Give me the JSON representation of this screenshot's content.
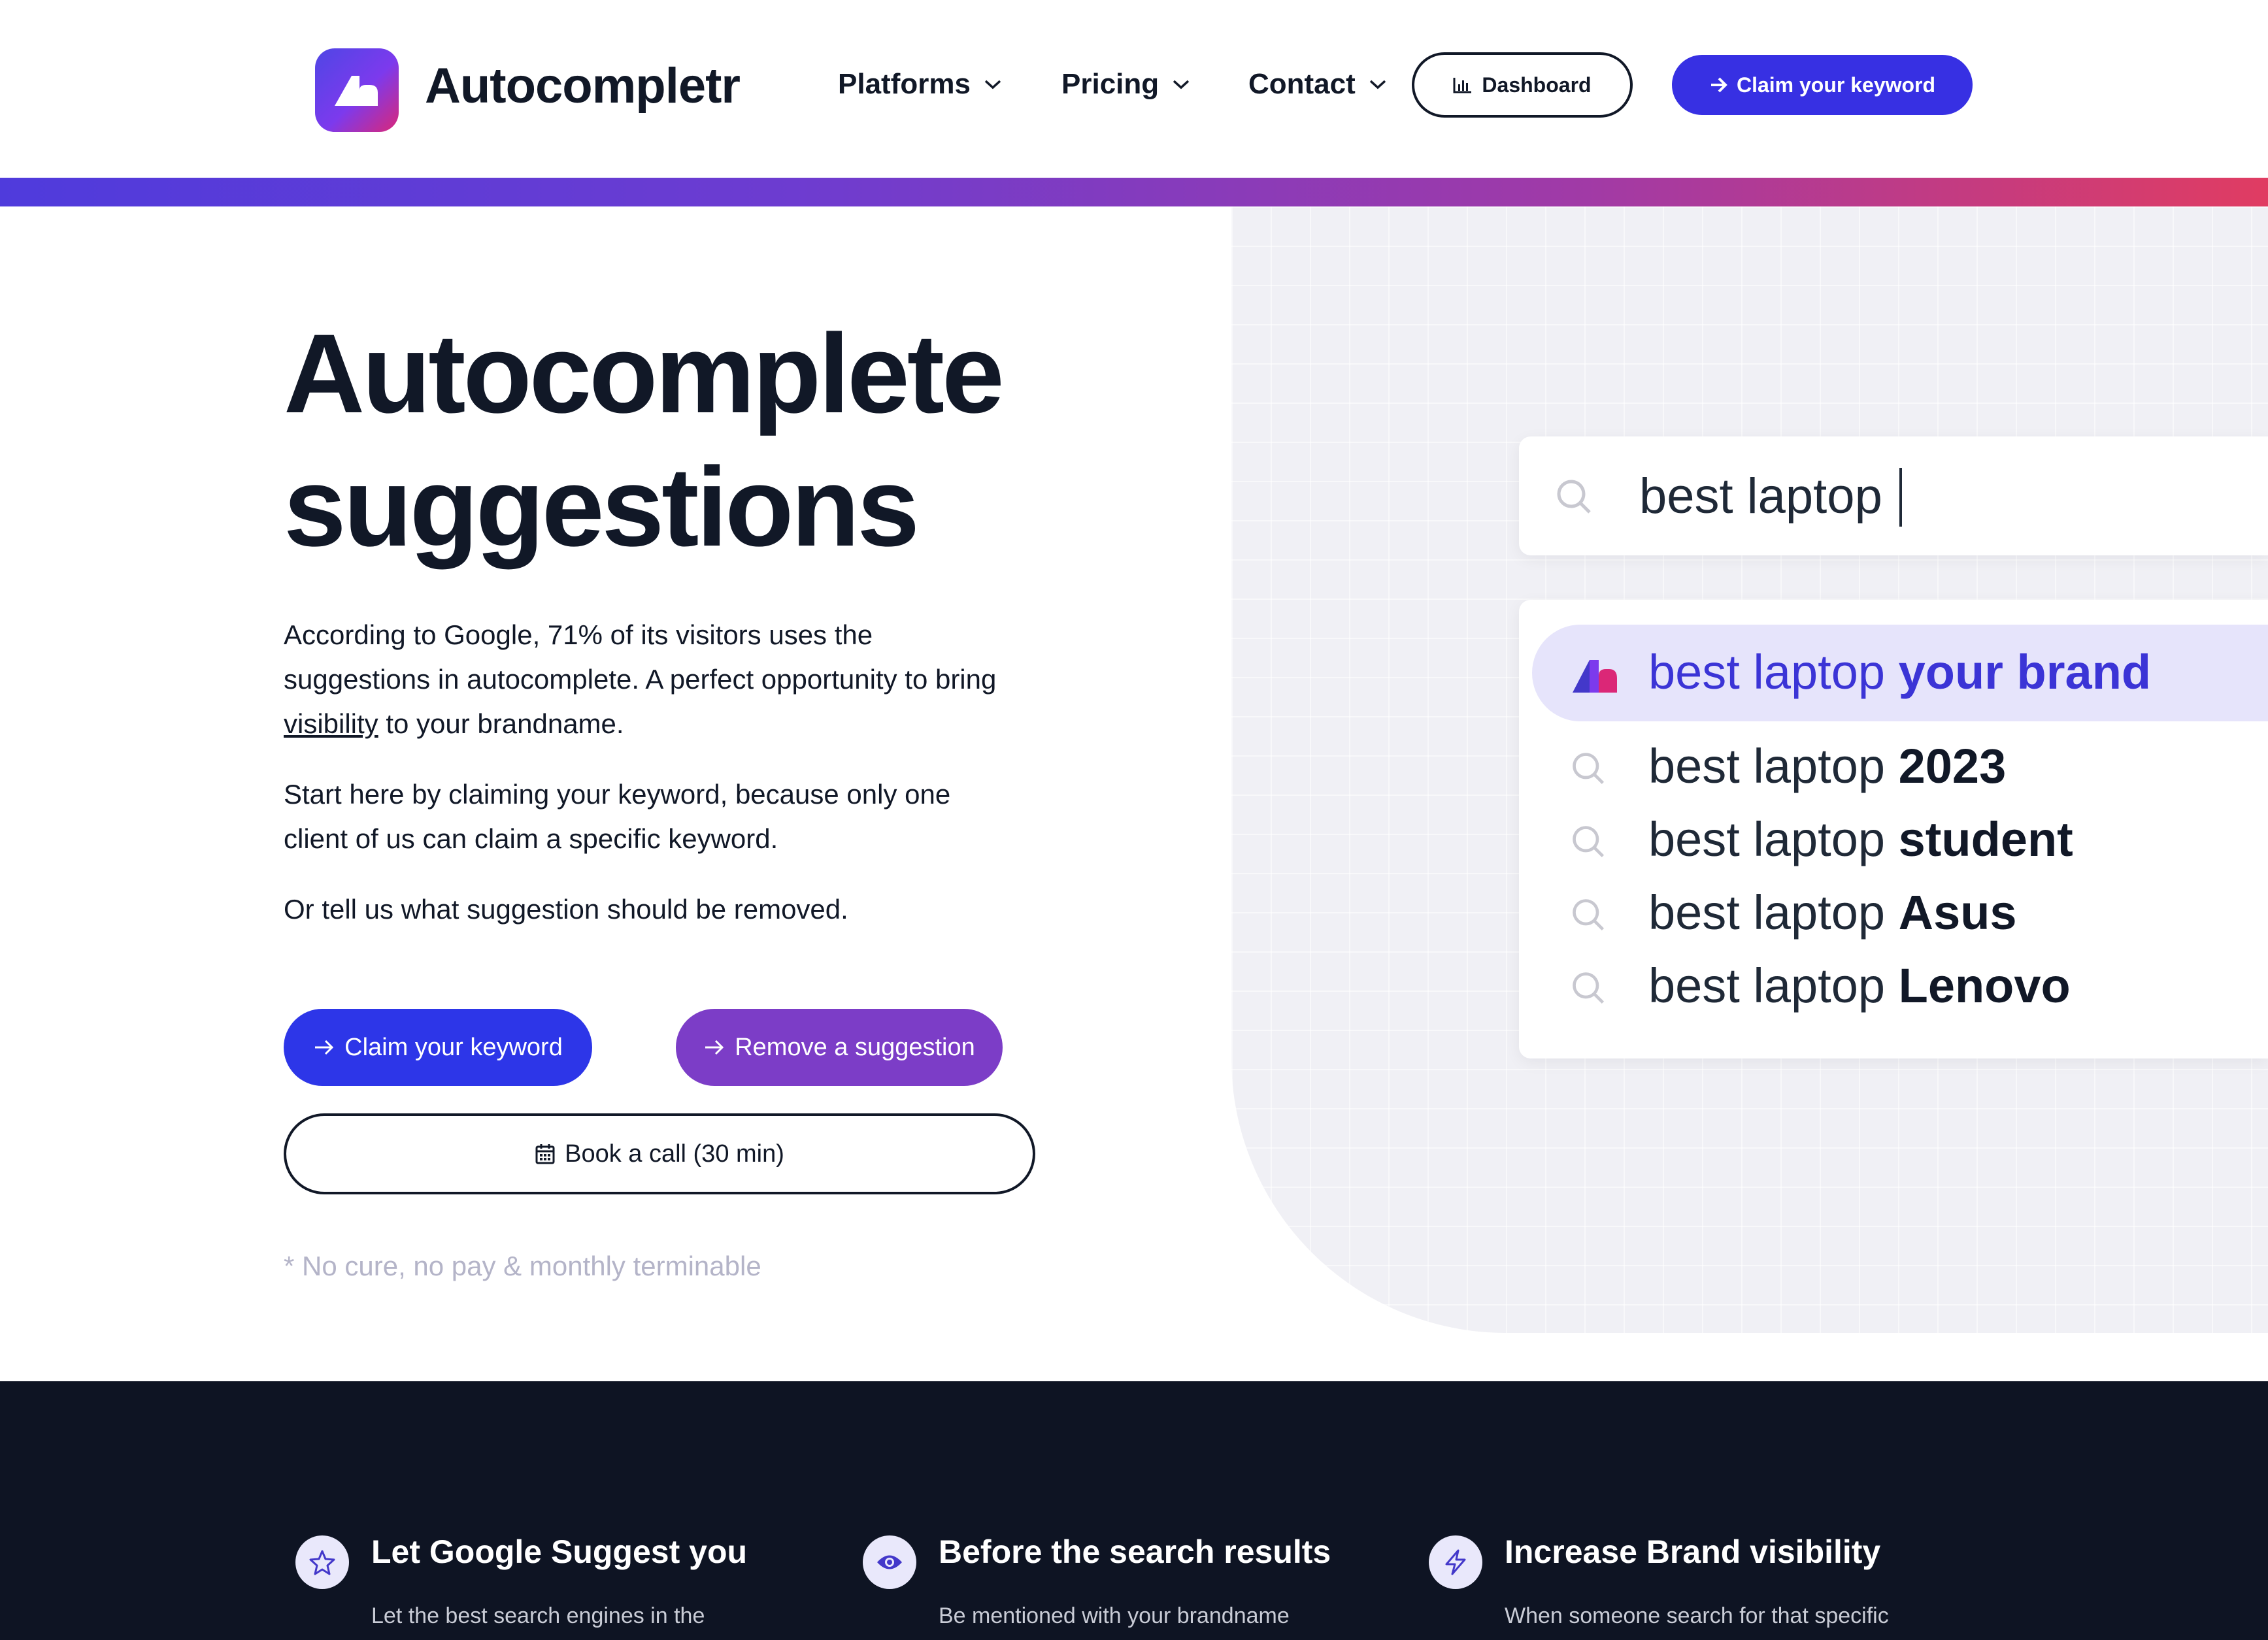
{
  "header": {
    "brand": "Autocompletr",
    "nav": [
      {
        "label": "Platforms"
      },
      {
        "label": "Pricing"
      },
      {
        "label": "Contact"
      }
    ],
    "dashboard_label": "Dashboard",
    "claim_label": "Claim your keyword"
  },
  "colors": {
    "accent_blue": "#3730e3",
    "accent_purple": "#7c3dc7",
    "dark_bg": "#0e1423",
    "highlight": "#e6e4fb"
  },
  "hero": {
    "title_line1": "Autocomplete",
    "title_line2": "suggestions",
    "p1_before": "According to Google, 71% of its visitors uses the suggestions in autocomplete. A perfect opportunity to bring ",
    "p1_link": "visibility",
    "p1_after": " to your brandname.",
    "p2": "Start here by claiming your keyword, because only one client of us can claim a specific keyword.",
    "p3": "Or tell us what suggestion should be removed.",
    "btn_claim": "Claim your keyword",
    "btn_remove": "Remove a suggestion",
    "btn_book": "Book a call (30 min)",
    "footnote": "* No cure, no pay & monthly terminable"
  },
  "search": {
    "query": "best laptop",
    "suggestions": [
      {
        "prefix": "best laptop",
        "bold": "your brand",
        "icon": "brand-logo-icon",
        "highlighted": true
      },
      {
        "prefix": "best laptop",
        "bold": "2023",
        "icon": "search-icon",
        "highlighted": false
      },
      {
        "prefix": "best laptop",
        "bold": "student",
        "icon": "search-icon",
        "highlighted": false
      },
      {
        "prefix": "best laptop",
        "bold": "Asus",
        "icon": "search-icon",
        "highlighted": false
      },
      {
        "prefix": "best laptop",
        "bold": "Lenovo",
        "icon": "search-icon",
        "highlighted": false
      }
    ]
  },
  "features": [
    {
      "icon": "star-icon",
      "title": "Let Google Suggest you",
      "text": "Let the best search engines in the"
    },
    {
      "icon": "eye-icon",
      "title": "Before the search results",
      "text": "Be mentioned with your brandname"
    },
    {
      "icon": "lightning-icon",
      "title": "Increase Brand visibility",
      "text": "When someone search for that specific"
    }
  ]
}
